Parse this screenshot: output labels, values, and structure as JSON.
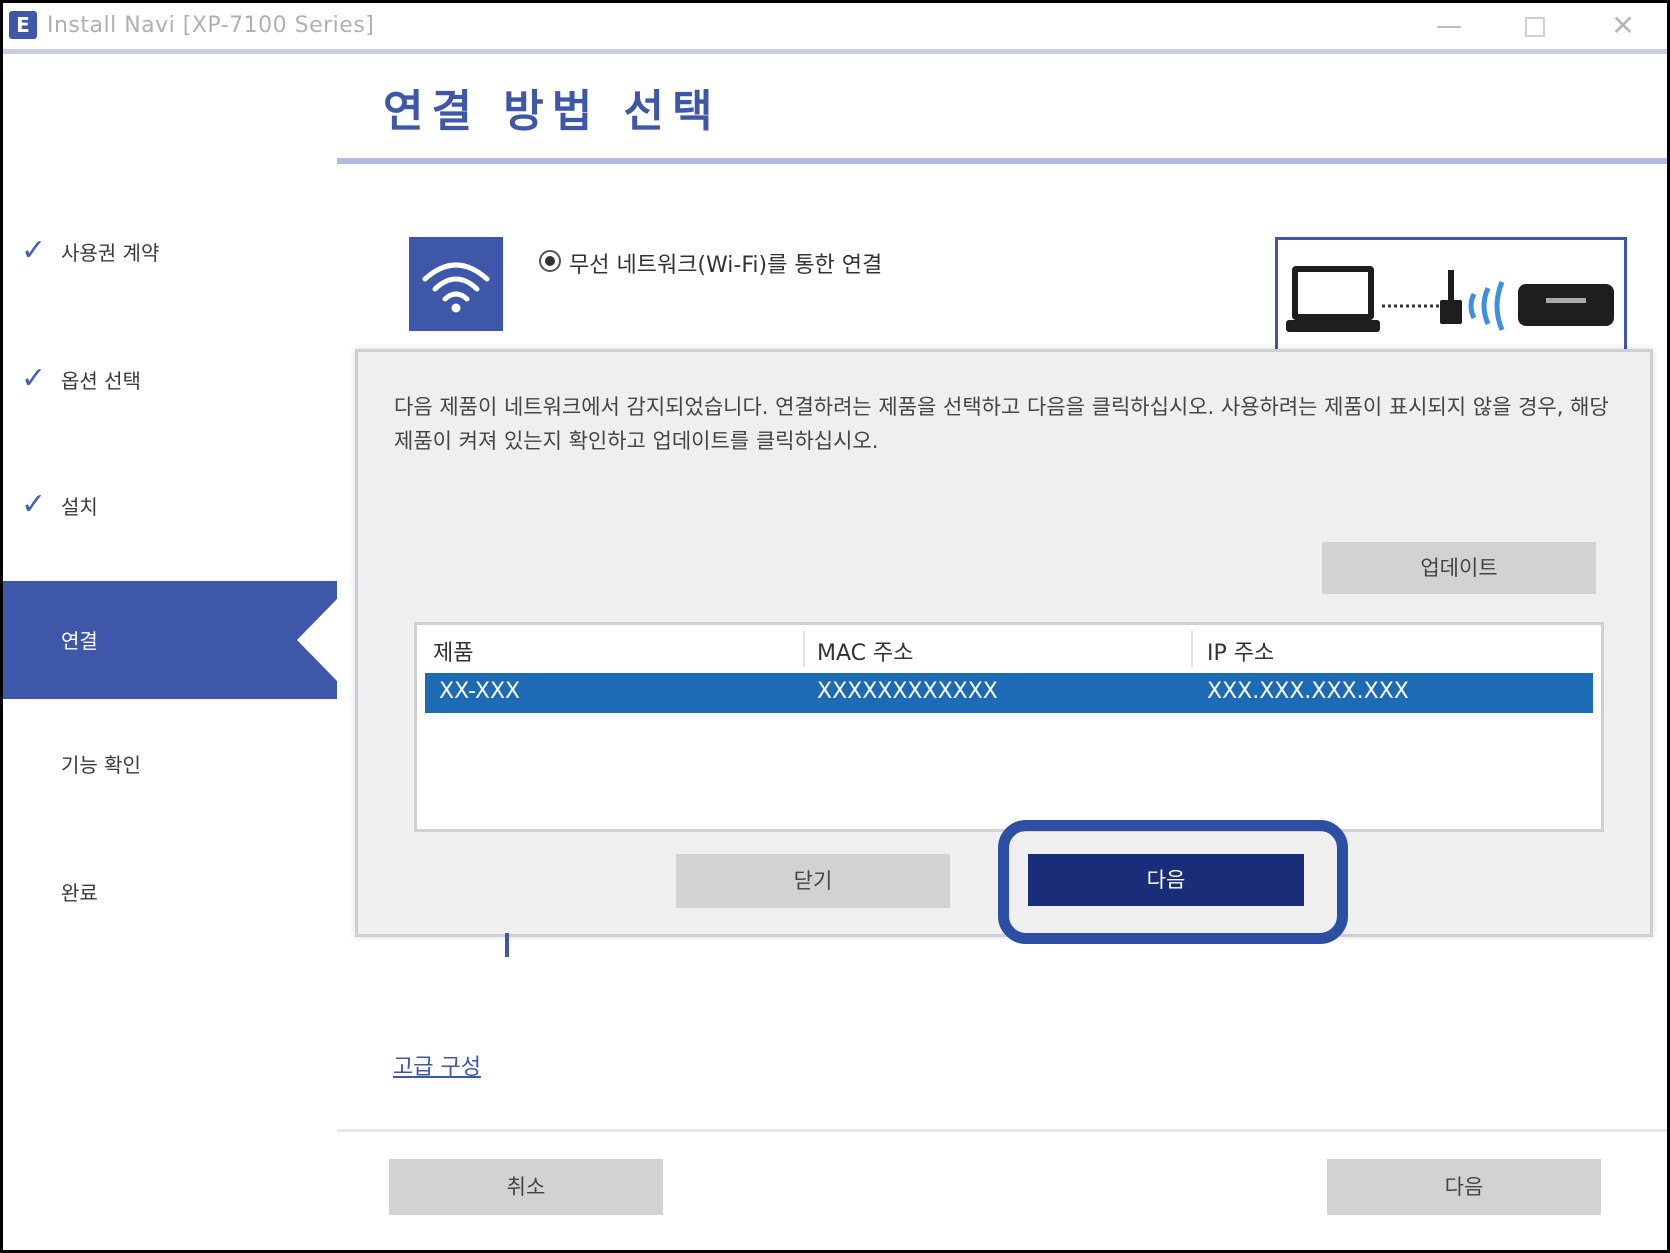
{
  "window": {
    "title": "Install Navi [XP-7100 Series]",
    "min_glyph": "—",
    "close_glyph": "✕"
  },
  "page": {
    "title": "연결 방법 선택"
  },
  "sidebar": {
    "items": [
      {
        "label": "사용권 계약",
        "state": "done"
      },
      {
        "label": "옵션 선택",
        "state": "done"
      },
      {
        "label": "설치",
        "state": "done"
      },
      {
        "label": "연결",
        "state": "active"
      },
      {
        "label": "기능 확인",
        "state": "pending"
      },
      {
        "label": "완료",
        "state": "pending"
      }
    ],
    "check_glyph": "✓"
  },
  "connection": {
    "option_label": "무선 네트워크(Wi-Fi)를 통한 연결",
    "icon": "wifi-icon"
  },
  "dialog": {
    "message": "다음 제품이 네트워크에서 감지되었습니다. 연결하려는 제품을 선택하고 다음을 클릭하십시오. 사용하려는 제품이 표시되지 않을 경우, 해당 제품이 켜져 있는지 확인하고 업데이트를 클릭하십시오.",
    "update_label": "업데이트",
    "columns": [
      "제품",
      "MAC 주소",
      "IP 주소"
    ],
    "rows": [
      [
        "XX-XXX",
        "XXXXXXXXXXXX",
        "XXX.XXX.XXX.XXX"
      ]
    ],
    "close_label": "닫기",
    "next_label": "다음"
  },
  "footer": {
    "advanced_link": "고급 구성",
    "cancel_label": "취소",
    "next_label": "다음"
  },
  "colors": {
    "accent": "#3f57a8",
    "selection": "#1d6bb5",
    "primary_button": "#1a2d79",
    "highlight_ring": "#2c4fa3"
  }
}
